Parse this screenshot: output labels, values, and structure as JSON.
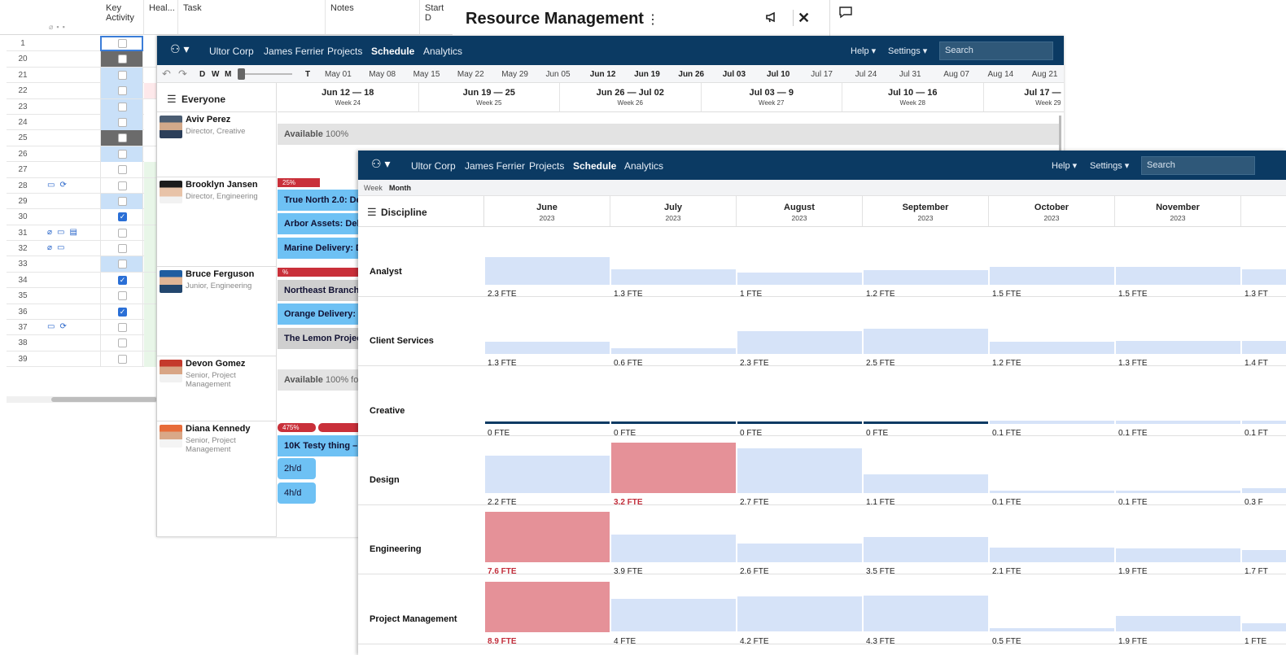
{
  "sheet": {
    "headers": {
      "key_activity": "Key\nActivity",
      "health": "Heal...",
      "task": "Task",
      "notes": "Notes",
      "start": "Start D"
    },
    "rows": [
      {
        "num": "1",
        "key": "sel",
        "check": "none",
        "icons": "",
        "health": ""
      },
      {
        "num": "20",
        "key": "dark",
        "check": "none",
        "icons": "",
        "health": ""
      },
      {
        "num": "21",
        "key": "blue",
        "check": "none",
        "icons": "",
        "health": ""
      },
      {
        "num": "22",
        "key": "blue",
        "check": "none",
        "icons": "",
        "health": "pink"
      },
      {
        "num": "23",
        "key": "blue",
        "check": "none",
        "icons": "",
        "health": ""
      },
      {
        "num": "24",
        "key": "blue",
        "check": "none",
        "icons": "",
        "health": ""
      },
      {
        "num": "25",
        "key": "dark",
        "check": "none",
        "icons": "",
        "health": ""
      },
      {
        "num": "26",
        "key": "blue",
        "check": "none",
        "icons": "",
        "health": ""
      },
      {
        "num": "27",
        "key": "",
        "check": "empty",
        "icons": "",
        "health": "green"
      },
      {
        "num": "28",
        "key": "",
        "check": "empty",
        "icons": "comment sync",
        "health": "green"
      },
      {
        "num": "29",
        "key": "blue",
        "check": "none",
        "icons": "",
        "health": "green"
      },
      {
        "num": "30",
        "key": "",
        "check": "checked",
        "icons": "",
        "health": "green"
      },
      {
        "num": "31",
        "key": "",
        "check": "empty",
        "icons": "attach comment proof",
        "health": "green"
      },
      {
        "num": "32",
        "key": "",
        "check": "empty",
        "icons": "attach comment",
        "health": "green"
      },
      {
        "num": "33",
        "key": "blue",
        "check": "none",
        "icons": "",
        "health": "green"
      },
      {
        "num": "34",
        "key": "",
        "check": "checked",
        "icons": "",
        "health": "green"
      },
      {
        "num": "35",
        "key": "",
        "check": "empty",
        "icons": "",
        "health": "green"
      },
      {
        "num": "36",
        "key": "",
        "check": "checked",
        "icons": "",
        "health": "green"
      },
      {
        "num": "37",
        "key": "",
        "check": "empty",
        "icons": "comment sync",
        "health": "green"
      },
      {
        "num": "38",
        "key": "",
        "check": "empty",
        "icons": "",
        "health": "green"
      },
      {
        "num": "39",
        "key": "",
        "check": "empty",
        "icons": "",
        "health": "green"
      }
    ]
  },
  "dialog": {
    "title": "Resource Management"
  },
  "nav": {
    "org": "Ultor Corp",
    "user": "James Ferrier",
    "projects": "Projects",
    "schedule": "Schedule",
    "analytics": "Analytics",
    "help": "Help ▾",
    "settings": "Settings ▾",
    "search_placeholder": "Search"
  },
  "schedule": {
    "toolbar": {
      "d": "D",
      "w": "W",
      "m": "M",
      "t": "T"
    },
    "timeline_dates": [
      "May 01",
      "May 08",
      "May 15",
      "May 22",
      "May 29",
      "Jun 05",
      "Jun 12",
      "Jun 19",
      "Jun 26",
      "Jul 03",
      "Jul 10",
      "Jul 17",
      "Jul 24",
      "Jul 31",
      "Aug 07",
      "Aug 14",
      "Aug 21"
    ],
    "everyone_label": "Everyone",
    "weeks": [
      {
        "range": "Jun 12 — 18",
        "week": "Week 24"
      },
      {
        "range": "Jun 19 — 25",
        "week": "Week 25"
      },
      {
        "range": "Jun 26 — Jul 02",
        "week": "Week 26"
      },
      {
        "range": "Jul 03 — 9",
        "week": "Week 27"
      },
      {
        "range": "Jul 10 — 16",
        "week": "Week 28"
      },
      {
        "range": "Jul 17 —",
        "week": "Week 29"
      }
    ],
    "people": [
      {
        "name": "Aviv Perez",
        "role": "Director, Creative"
      },
      {
        "name": "Brooklyn Jansen",
        "role": "Director, Engineering"
      },
      {
        "name": "Bruce Ferguson",
        "role": "Junior, Engineering"
      },
      {
        "name": "Devon Gomez",
        "role": "Senior, Project Management"
      },
      {
        "name": "Diana Kennedy",
        "role": "Senior, Project Management"
      }
    ],
    "avail1": {
      "label": "Available",
      "pct": "100%"
    },
    "avail2": {
      "label": "Available",
      "pct": "100% fo"
    },
    "bars": {
      "brooklyn_pct": "25%",
      "bruce_pct": "%",
      "diana_pct": "475%"
    },
    "tasks": {
      "t1": "True North 2.0: De",
      "t2": "Arbor Assets: Deli",
      "t3": "Marine Delivery: D",
      "t4": "Northeast Branch",
      "t5": "Orange Delivery: I",
      "t6": "The Lemon Project",
      "t7": "10K Testy thing – A",
      "p1": "2h/d",
      "p2": "4h/d"
    }
  },
  "resource": {
    "view_week": "Week",
    "view_month": "Month",
    "discipline_label": "Discipline",
    "months": [
      {
        "name": "June",
        "year": "2023"
      },
      {
        "name": "July",
        "year": "2023"
      },
      {
        "name": "August",
        "year": "2023"
      },
      {
        "name": "September",
        "year": "2023"
      },
      {
        "name": "October",
        "year": "2023"
      },
      {
        "name": "November",
        "year": "2023"
      }
    ],
    "disciplines": [
      {
        "name": "Analyst",
        "values": [
          {
            "v": "2.3 FTE",
            "f": 0.55
          },
          {
            "v": "1.3 FTE",
            "f": 0.31
          },
          {
            "v": "1 FTE",
            "f": 0.24
          },
          {
            "v": "1.2 FTE",
            "f": 0.29
          },
          {
            "v": "1.5 FTE",
            "f": 0.36
          },
          {
            "v": "1.5 FTE",
            "f": 0.36
          },
          {
            "v": "1.3 FT",
            "f": 0.31
          }
        ]
      },
      {
        "name": "Client Services",
        "values": [
          {
            "v": "1.3 FTE",
            "f": 0.25
          },
          {
            "v": "0.6 FTE",
            "f": 0.11
          },
          {
            "v": "2.3 FTE",
            "f": 0.45
          },
          {
            "v": "2.5 FTE",
            "f": 0.5
          },
          {
            "v": "1.2 FTE",
            "f": 0.24
          },
          {
            "v": "1.3 FTE",
            "f": 0.26
          },
          {
            "v": "1.4 FT",
            "f": 0.27
          }
        ]
      },
      {
        "name": "Creative",
        "values": [
          {
            "v": "0 FTE",
            "f": -1
          },
          {
            "v": "0 FTE",
            "f": -1
          },
          {
            "v": "0 FTE",
            "f": -1
          },
          {
            "v": "0 FTE",
            "f": -1
          },
          {
            "v": "0.1 FTE",
            "f": 0.06
          },
          {
            "v": "0.1 FTE",
            "f": 0.06
          },
          {
            "v": "0.1 FT",
            "f": 0.06
          }
        ]
      },
      {
        "name": "Design",
        "values": [
          {
            "v": "2.2 FTE",
            "f": 0.74
          },
          {
            "v": "3.2 FTE",
            "f": 1.0,
            "over": true
          },
          {
            "v": "2.7 FTE",
            "f": 0.89
          },
          {
            "v": "1.1 FTE",
            "f": 0.37
          },
          {
            "v": "0.1 FTE",
            "f": 0.05
          },
          {
            "v": "0.1 FTE",
            "f": 0.05
          },
          {
            "v": "0.3 F",
            "f": 0.1
          }
        ]
      },
      {
        "name": "Engineering",
        "values": [
          {
            "v": "7.6 FTE",
            "f": 1.0,
            "over": true
          },
          {
            "v": "3.9 FTE",
            "f": 0.55
          },
          {
            "v": "2.6 FTE",
            "f": 0.37
          },
          {
            "v": "3.5 FTE",
            "f": 0.5
          },
          {
            "v": "2.1 FTE",
            "f": 0.3
          },
          {
            "v": "1.9 FTE",
            "f": 0.27
          },
          {
            "v": "1.7 FT",
            "f": 0.24
          }
        ]
      },
      {
        "name": "Project Management",
        "values": [
          {
            "v": "8.9 FTE",
            "f": 1.0,
            "over": true
          },
          {
            "v": "4 FTE",
            "f": 0.65
          },
          {
            "v": "4.2 FTE",
            "f": 0.7
          },
          {
            "v": "4.3 FTE",
            "f": 0.71
          },
          {
            "v": "0.5 FTE",
            "f": 0.08
          },
          {
            "v": "1.9 FTE",
            "f": 0.31
          },
          {
            "v": "1 FTE",
            "f": 0.17
          }
        ]
      }
    ]
  }
}
